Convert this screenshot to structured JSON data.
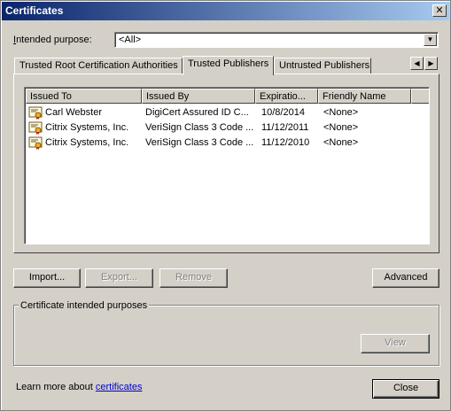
{
  "window": {
    "title": "Certificates",
    "close_glyph": "✕"
  },
  "purpose": {
    "label": "Intended purpose:",
    "value": "<All>"
  },
  "tabs": [
    {
      "label": "Trusted Root Certification Authorities"
    },
    {
      "label": "Trusted Publishers"
    },
    {
      "label": "Untrusted Publishers"
    }
  ],
  "columns": [
    "Issued To",
    "Issued By",
    "Expiratio...",
    "Friendly Name"
  ],
  "rows": [
    {
      "issued_to": "Carl Webster",
      "issued_by": "DigiCert Assured ID C...",
      "expiration": "10/8/2014",
      "friendly": "<None>"
    },
    {
      "issued_to": "Citrix Systems, Inc.",
      "issued_by": "VeriSign Class 3 Code ...",
      "expiration": "11/12/2011",
      "friendly": "<None>"
    },
    {
      "issued_to": "Citrix Systems, Inc.",
      "issued_by": "VeriSign Class 3 Code ...",
      "expiration": "11/12/2010",
      "friendly": "<None>"
    }
  ],
  "buttons": {
    "import": "Import...",
    "export": "Export...",
    "remove": "Remove",
    "advanced": "Advanced",
    "view": "View",
    "close": "Close"
  },
  "group": {
    "title": "Certificate intended purposes"
  },
  "footer": {
    "prefix": "Learn more about ",
    "link": "certificates"
  },
  "icons": {
    "close": "close-icon",
    "dropdown": "chevron-down-icon",
    "scroll_left": "arrow-left-icon",
    "scroll_right": "arrow-right-icon",
    "certificate": "certificate-icon"
  },
  "colors": {
    "title_start": "#0a246a",
    "title_end": "#a6caf0",
    "face": "#d4d0c8",
    "link": "#0000cc"
  }
}
